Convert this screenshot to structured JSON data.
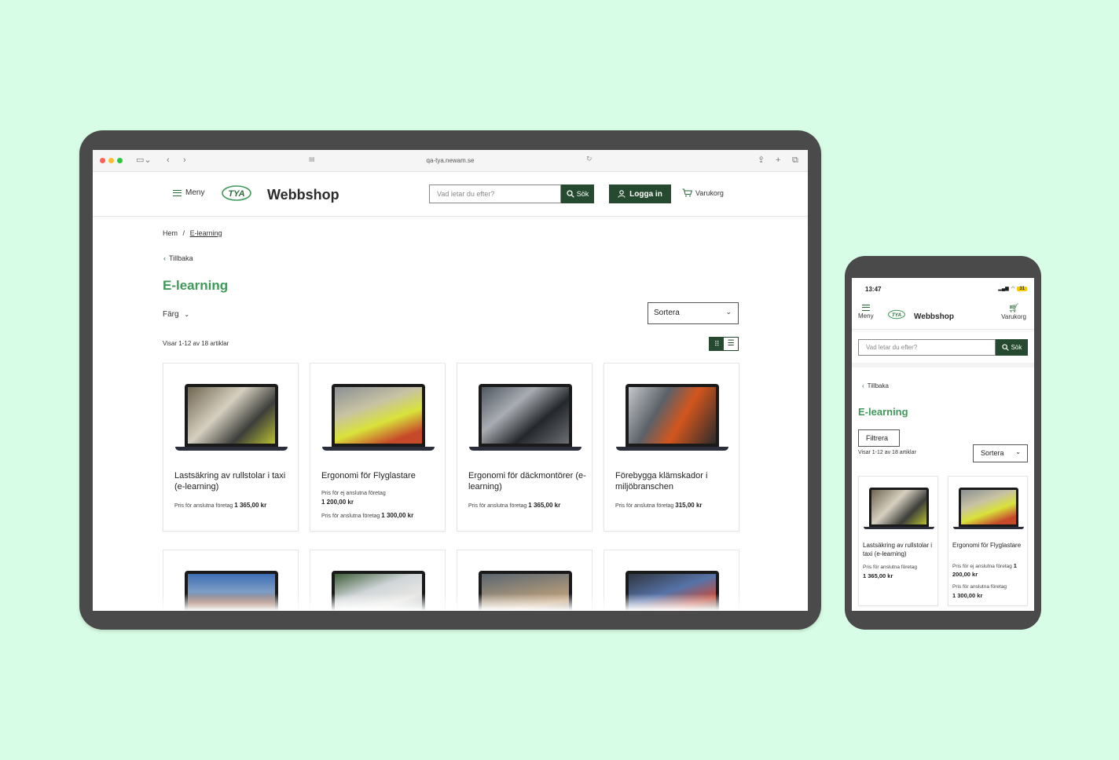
{
  "browser": {
    "url": "qa-tya.newam.se"
  },
  "header": {
    "menu_label": "Meny",
    "logo_text": "TYA",
    "title": "Webbshop",
    "search_placeholder": "Vad letar du efter?",
    "search_button": "Sök",
    "login_button": "Logga in",
    "cart_label": "Varukorg"
  },
  "breadcrumb": {
    "home": "Hem",
    "separator": "/",
    "current": "E-learning"
  },
  "back_label": "Tillbaka",
  "page_title": "E-learning",
  "filter_label": "Färg",
  "sort_label": "Sortera",
  "count_text": "Visar 1-12 av 18 artiklar",
  "products": [
    {
      "name": "Lastsäkring av rullstolar i taxi (e-learning)",
      "price_label": "Pris för anslutna företag",
      "price": "1 365,00 kr"
    },
    {
      "name": "Ergonomi för Flyglastare",
      "price_label_1": "Pris för ej anslutna företag",
      "price_1": "1 200,00 kr",
      "price_label_2": "Pris för anslutna företag",
      "price_2": "1 300,00 kr"
    },
    {
      "name": "Ergonomi för däckmontö­rer (e-learning)",
      "price_label": "Pris för anslutna företag",
      "price": "1 365,00 kr"
    },
    {
      "name": "Förebygga klämskador i miljöbranschen",
      "price_label": "Pris för anslutna företag",
      "price": "315,00 kr"
    }
  ],
  "mobile": {
    "time": "13:47",
    "battery": "31",
    "menu_label": "Meny",
    "title": "Webbshop",
    "cart_label": "Varukorg",
    "search_placeholder": "Vad letar du efter?",
    "search_button": "Sök",
    "back_label": "Tillbaka",
    "page_title": "E-learning",
    "filter_button": "Filtrera",
    "sort_label": "Sortera",
    "count_text": "Visar 1-12 av 18 artiklar",
    "products": [
      {
        "name": "Lastsäkring av rullsto­lar i taxi (e-learning)",
        "price_label": "Pris för anslutna företag",
        "price": "1 365,00 kr"
      },
      {
        "name": "Ergonomi för Flyglas­tare",
        "price_label_1": "Pris för ej anslutna företag",
        "price_1": "1 200,00 kr",
        "price_label_2": "Pris för anslutna företag",
        "price_2": "1 300,00 kr"
      }
    ]
  },
  "colors": {
    "background": "#d8fde6",
    "brand_green": "#3e9a58",
    "dark_green": "#254a2f",
    "device_frame": "#4a4a4a"
  },
  "icons": [
    "sidebar-icon",
    "back-arrow-icon",
    "forward-arrow-icon",
    "share-icon",
    "new-tab-icon",
    "tabs-icon",
    "search-icon",
    "user-icon",
    "cart-icon",
    "grid-view-icon",
    "list-view-icon"
  ]
}
